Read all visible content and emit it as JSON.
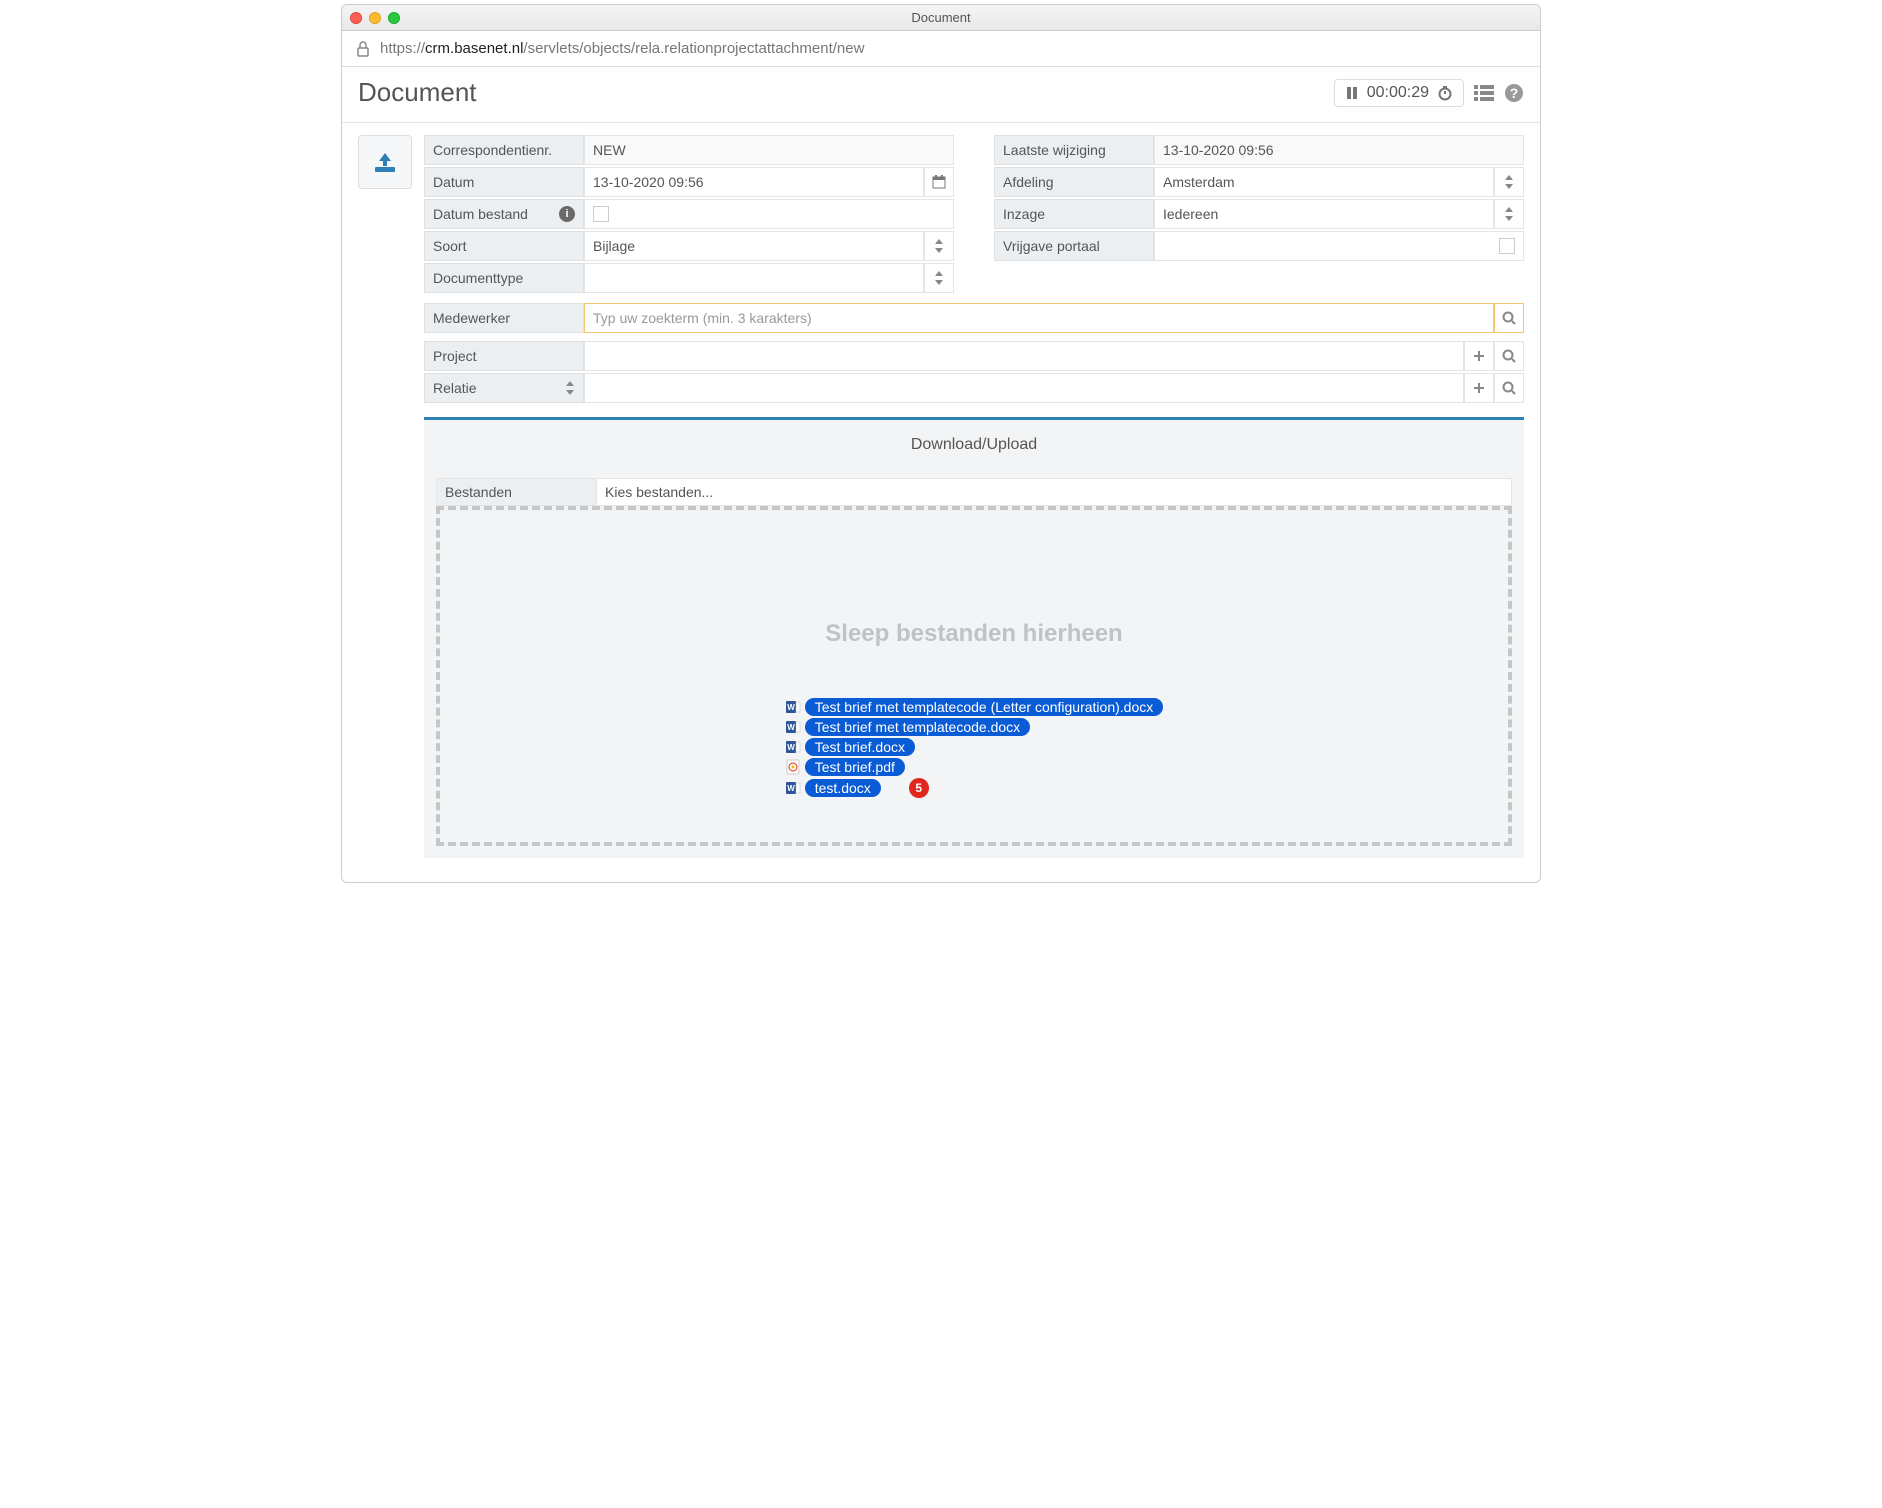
{
  "window": {
    "title": "Document"
  },
  "url": {
    "host": "crm.basenet.nl",
    "path": "/servlets/objects/rela.relationprojectattachment/new"
  },
  "header": {
    "title": "Document",
    "timer": "00:00:29"
  },
  "form": {
    "correspondentienr": {
      "label": "Correspondentienr.",
      "value": "NEW"
    },
    "datum": {
      "label": "Datum",
      "value": "13-10-2020 09:56"
    },
    "datum_bestand": {
      "label": "Datum bestand"
    },
    "soort": {
      "label": "Soort",
      "value": "Bijlage"
    },
    "documenttype": {
      "label": "Documenttype",
      "value": ""
    },
    "laatste_wijziging": {
      "label": "Laatste wijziging",
      "value": "13-10-2020 09:56"
    },
    "afdeling": {
      "label": "Afdeling",
      "value": "Amsterdam"
    },
    "inzage": {
      "label": "Inzage",
      "value": "Iedereen"
    },
    "vrijgave_portaal": {
      "label": "Vrijgave portaal"
    },
    "medewerker": {
      "label": "Medewerker",
      "placeholder": "Typ uw zoekterm (min.  3 karakters)"
    },
    "project": {
      "label": "Project"
    },
    "relatie": {
      "label": "Relatie"
    }
  },
  "upload": {
    "panel_title": "Download/Upload",
    "bestanden_label": "Bestanden",
    "bestanden_value": "Kies bestanden...",
    "dropzone_text": "Sleep bestanden hierheen",
    "count_badge": "5",
    "files": [
      {
        "name": "Test brief met templatecode (Letter configuration).docx",
        "type": "word"
      },
      {
        "name": "Test brief met templatecode.docx",
        "type": "word"
      },
      {
        "name": "Test brief.docx",
        "type": "word"
      },
      {
        "name": "Test brief.pdf",
        "type": "pdf"
      },
      {
        "name": "test.docx",
        "type": "word"
      }
    ]
  }
}
